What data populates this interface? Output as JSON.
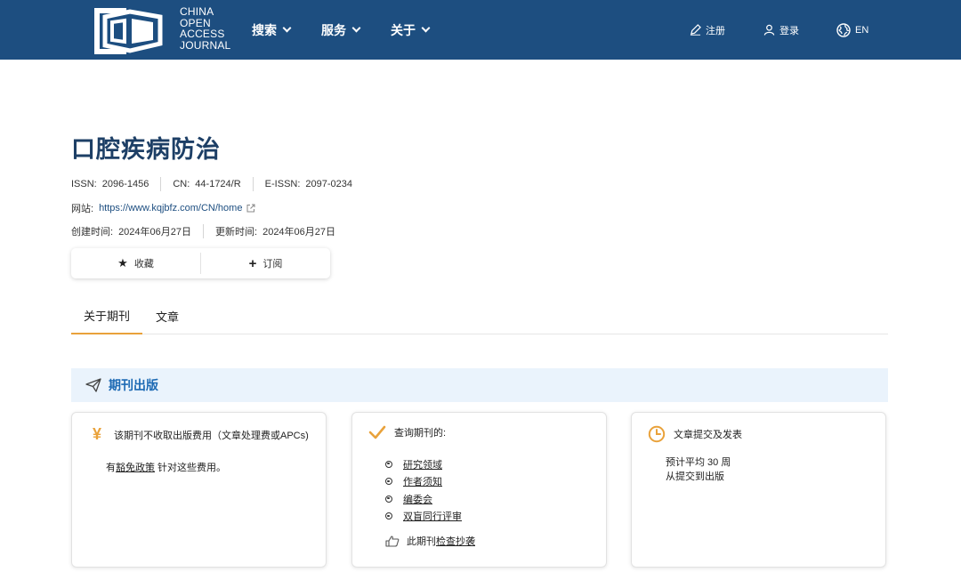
{
  "header": {
    "logo_lines": [
      "CHINA",
      "OPEN",
      "ACCESS",
      "JOURNAL"
    ],
    "nav": [
      {
        "label": "搜索"
      },
      {
        "label": "服务"
      },
      {
        "label": "关于"
      }
    ],
    "register_label": "注册",
    "login_label": "登录",
    "lang_label": "EN"
  },
  "journal": {
    "title": "口腔疾病防治",
    "issn_label": "ISSN:",
    "issn": "2096-1456",
    "cn_label": "CN:",
    "cn": "44-1724/R",
    "eissn_label": "E-ISSN:",
    "eissn": "2097-0234",
    "website_label": "网站:",
    "website": "https://www.kqjbfz.com/CN/home",
    "created_label": "创建时间:",
    "created": "2024年06月27日",
    "updated_label": "更新时间:",
    "updated": "2024年06月27日"
  },
  "actions": {
    "favorite_label": "收藏",
    "subscribe_label": "订阅"
  },
  "tabs": [
    {
      "label": "关于期刊",
      "active": true
    },
    {
      "label": "文章",
      "active": false
    }
  ],
  "section": {
    "title": "期刊出版"
  },
  "cards": {
    "fees": {
      "title": "该期刊不收取出版费用（文章处理费或APCs)",
      "body_prefix": "有",
      "body_link": "豁免政策",
      "body_suffix": " 针对这些费用。"
    },
    "query": {
      "title": "查询期刊的:",
      "items": [
        "研究领域",
        "作者须知",
        "编委会",
        "双盲同行评审"
      ],
      "plag_prefix": "此期刊",
      "plag_link": "检查抄袭"
    },
    "timeline": {
      "title": "文章提交及发表",
      "line1": "预计平均 30 周",
      "line2": "从提交到出版"
    }
  },
  "colors": {
    "header_bg": "#1d4e80",
    "accent": "#e9a23b",
    "title": "#1d3f66",
    "section_bg": "#eaf3fc",
    "section_text": "#1d6ab4"
  }
}
